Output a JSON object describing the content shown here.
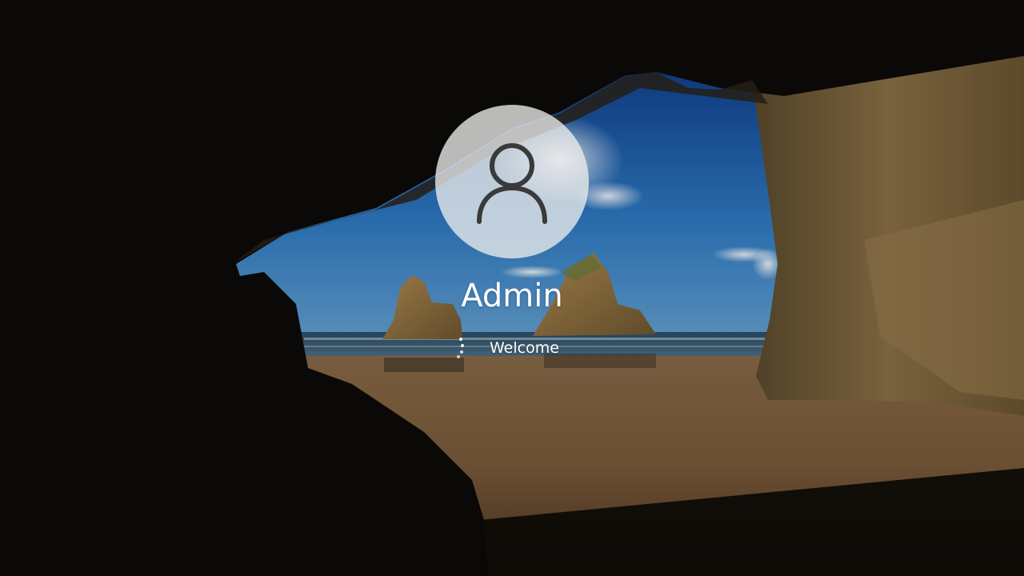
{
  "lock_screen": {
    "username": "Admin",
    "status_text": "Welcome"
  },
  "icons": {
    "avatar": "user-silhouette-icon",
    "spinner": "loading-spinner-icon"
  },
  "colors": {
    "text": "#ffffff",
    "avatar_circle": "#ececec",
    "user_glyph": "#3a3a3a"
  }
}
